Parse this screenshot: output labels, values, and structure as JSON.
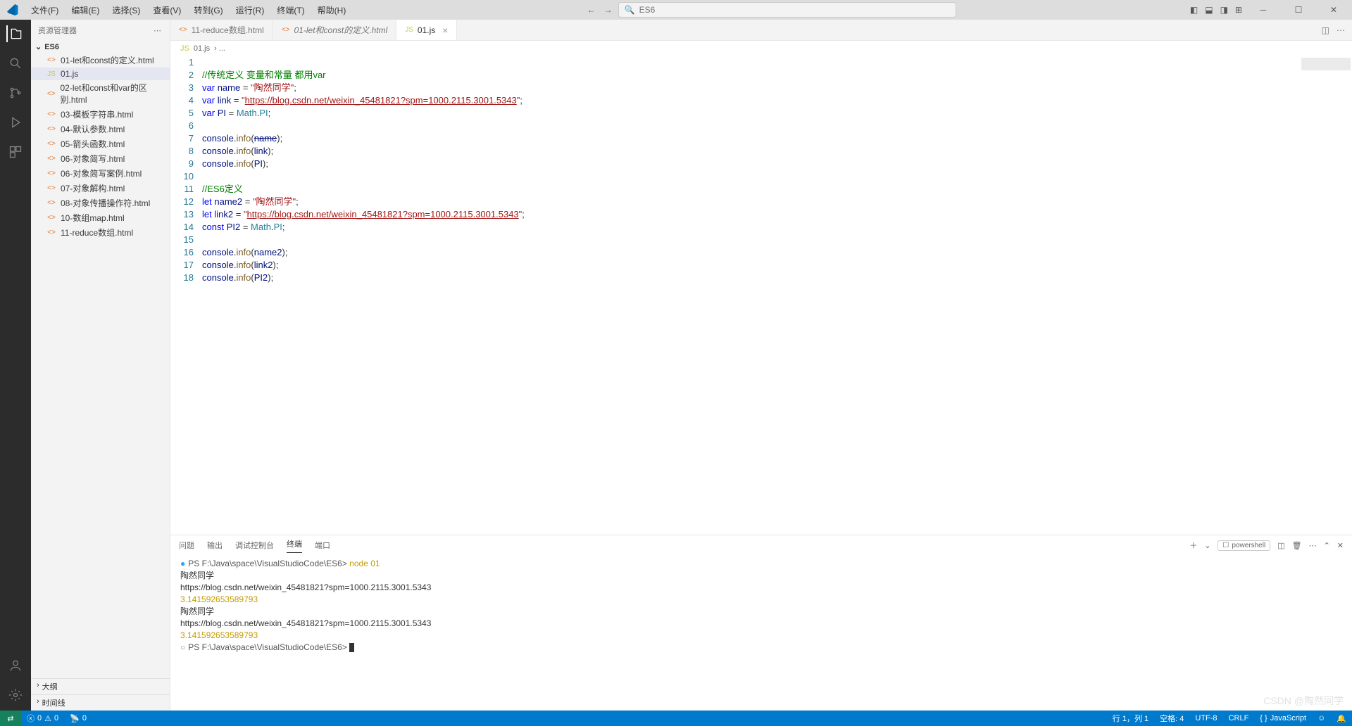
{
  "menu": [
    "文件(F)",
    "编辑(E)",
    "选择(S)",
    "查看(V)",
    "转到(G)",
    "运行(R)",
    "终端(T)",
    "帮助(H)"
  ],
  "search_placeholder": "ES6",
  "sidebar": {
    "title": "资源管理器",
    "folder": "ES6",
    "files": [
      {
        "icon": "<>",
        "label": "01-let和const的定义.html"
      },
      {
        "icon": "JS",
        "label": "01.js",
        "active": true,
        "js": true
      },
      {
        "icon": "<>",
        "label": "02-let和const和var的区别.html"
      },
      {
        "icon": "<>",
        "label": "03-模板字符串.html"
      },
      {
        "icon": "<>",
        "label": "04-默认参数.html"
      },
      {
        "icon": "<>",
        "label": "05-箭头函数.html"
      },
      {
        "icon": "<>",
        "label": "06-对象简写.html"
      },
      {
        "icon": "<>",
        "label": "06-对象简写案例.html"
      },
      {
        "icon": "<>",
        "label": "07-对象解构.html"
      },
      {
        "icon": "<>",
        "label": "08-对象传播操作符.html"
      },
      {
        "icon": "<>",
        "label": "10-数组map.html"
      },
      {
        "icon": "<>",
        "label": "11-reduce数组.html"
      }
    ],
    "outline": "大纲",
    "timeline": "时间线"
  },
  "tabs": [
    {
      "icon": "<>",
      "label": "11-reduce数组.html"
    },
    {
      "icon": "<>",
      "label": "01-let和const的定义.html",
      "italic": true
    },
    {
      "icon": "JS",
      "label": "01.js",
      "active": true,
      "js": true,
      "closable": true
    }
  ],
  "breadcrumb": {
    "icon": "JS",
    "file": "01.js",
    "rest": "› ..."
  },
  "code": {
    "lines": [
      {
        "n": 1,
        "html": ""
      },
      {
        "n": 2,
        "html": "<span class='c-com'>//传统定义 变量和常量 都用var</span>"
      },
      {
        "n": 3,
        "html": "<span class='c-kw'>var</span> <span class='c-var'>name</span> = <span class='c-str'>\"陶然同学\"</span>;"
      },
      {
        "n": 4,
        "html": "<span class='c-kw'>var</span> <span class='c-var'>link</span> = <span class='c-str'>\"<span class='underline'>https://blog.csdn.net/weixin_45481821?spm=1000.2115.3001.5343</span>\"</span>;"
      },
      {
        "n": 5,
        "html": "<span class='c-kw'>var</span> <span class='c-var'>PI</span> = <span class='c-cls'>Math</span>.<span class='c-mem'>PI</span>;"
      },
      {
        "n": 6,
        "html": ""
      },
      {
        "n": 7,
        "html": "<span class='c-var'>console</span>.<span class='c-fn'>info</span>(<span class='c-var strike'>name</span>);"
      },
      {
        "n": 8,
        "html": "<span class='c-var'>console</span>.<span class='c-fn'>info</span>(<span class='c-var'>link</span>);"
      },
      {
        "n": 9,
        "html": "<span class='c-var'>console</span>.<span class='c-fn'>info</span>(<span class='c-var'>PI</span>);"
      },
      {
        "n": 10,
        "html": ""
      },
      {
        "n": 11,
        "html": "<span class='c-com'>//ES6定义</span>"
      },
      {
        "n": 12,
        "html": "<span class='c-kw'>let</span> <span class='c-var'>name2</span> = <span class='c-str'>\"陶然同学\"</span>;"
      },
      {
        "n": 13,
        "html": "<span class='c-kw'>let</span> <span class='c-var'>link2</span> = <span class='c-str'>\"<span class='underline'>https://blog.csdn.net/weixin_45481821?spm=1000.2115.3001.5343</span>\"</span>;"
      },
      {
        "n": 14,
        "html": "<span class='c-kw'>const</span> <span class='c-var'>PI2</span> = <span class='c-cls'>Math</span>.<span class='c-mem'>PI</span>;"
      },
      {
        "n": 15,
        "html": ""
      },
      {
        "n": 16,
        "html": "<span class='c-var'>console</span>.<span class='c-fn'>info</span>(<span class='c-var'>name2</span>);"
      },
      {
        "n": 17,
        "html": "<span class='c-var'>console</span>.<span class='c-fn'>info</span>(<span class='c-var'>link2</span>);"
      },
      {
        "n": 18,
        "html": "<span class='c-var'>console</span>.<span class='c-fn'>info</span>(<span class='c-var'>PI2</span>);"
      }
    ]
  },
  "panel": {
    "tabs": [
      "问题",
      "输出",
      "调试控制台",
      "终端",
      "端口"
    ],
    "active": "终端",
    "shell": "powershell",
    "term": [
      {
        "type": "prompt",
        "bullet": "●",
        "path": "PS F:\\Java\\space\\VisualStudioCode\\ES6>",
        "cmd": " node 01"
      },
      {
        "type": "out",
        "text": "陶然同学"
      },
      {
        "type": "out",
        "text": "https://blog.csdn.net/weixin_45481821?spm=1000.2115.3001.5343"
      },
      {
        "type": "num",
        "text": "3.141592653589793"
      },
      {
        "type": "out",
        "text": "陶然同学"
      },
      {
        "type": "out",
        "text": "https://blog.csdn.net/weixin_45481821?spm=1000.2115.3001.5343"
      },
      {
        "type": "num",
        "text": "3.141592653589793"
      },
      {
        "type": "prompt",
        "bullet": "○",
        "path": "PS F:\\Java\\space\\VisualStudioCode\\ES6>",
        "cursor": true
      }
    ]
  },
  "status": {
    "errors": "0",
    "warnings": "0",
    "ports": "0",
    "ln": "行 1，列 1",
    "spaces": "空格: 4",
    "enc": "UTF-8",
    "eol": "CRLF",
    "lang": "JavaScript"
  },
  "watermark": "CSDN @陶然同学"
}
